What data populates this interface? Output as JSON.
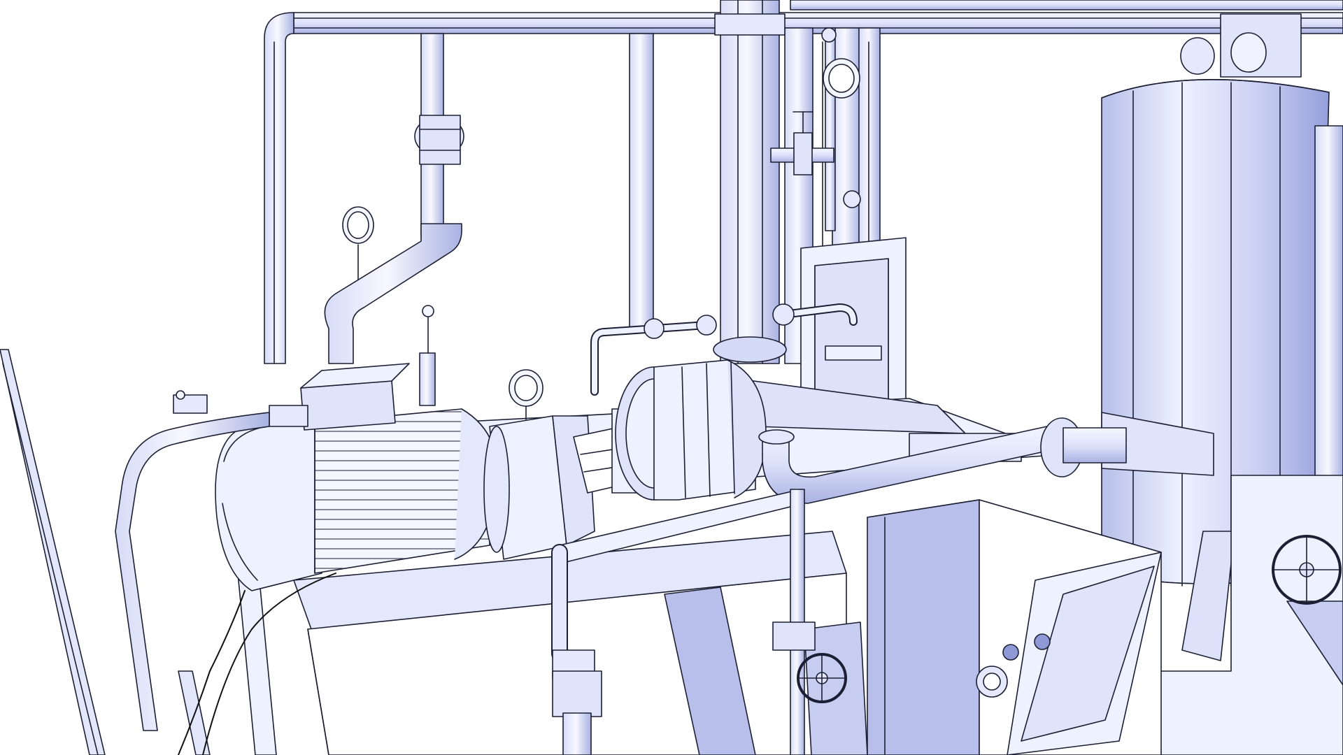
{
  "scene": {
    "background": "#ffffff",
    "colors": {
      "fill": "#eef1ff",
      "fill_mid": "#d9def8",
      "shade": "#b3bbe6",
      "shade_dark": "#8f99d6",
      "line": "#1c1f33",
      "wire": "#111111"
    }
  }
}
